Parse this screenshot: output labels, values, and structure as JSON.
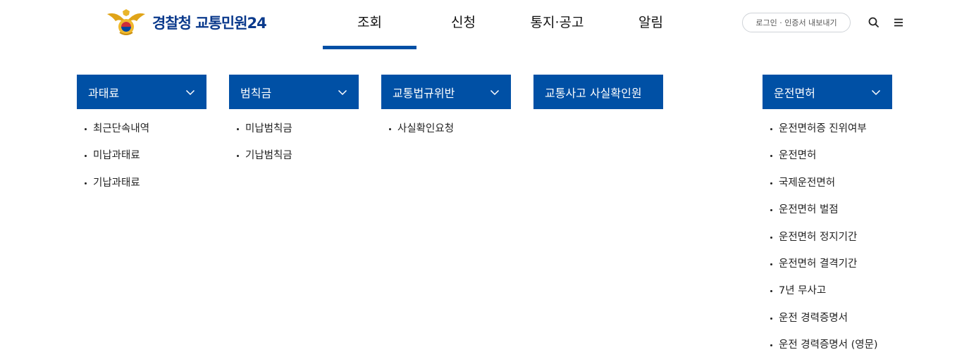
{
  "header": {
    "logo_text": "경찰청 교통민원24",
    "logo_icon": "police-emblem-icon",
    "nav": [
      {
        "label": "조회",
        "active": true
      },
      {
        "label": "신청",
        "active": false
      },
      {
        "label": "통지·공고",
        "active": false
      },
      {
        "label": "알림",
        "active": false
      }
    ],
    "login_label": "로그인  · 인증서 내보내기",
    "search_icon": "search-icon",
    "menu_icon": "menu-icon",
    "accent_color": "#0050a5"
  },
  "menu": {
    "columns": [
      {
        "title": "과태료",
        "has_toggle": true,
        "items": [
          "최근단속내역",
          "미납과태료",
          "기납과태료"
        ]
      },
      {
        "title": "범칙금",
        "has_toggle": true,
        "items": [
          "미납범칙금",
          "기납범칙금"
        ]
      },
      {
        "title": "교통법규위반",
        "has_toggle": true,
        "items": [
          "사실확인요청"
        ]
      },
      {
        "title": "교통사고 사실확인원",
        "has_toggle": false,
        "items": []
      },
      {
        "title": "운전면허",
        "has_toggle": true,
        "items": [
          "운전면허증 진위여부",
          "운전면허",
          "국제운전면허",
          "운전면허 벌점",
          "운전면허 정지기간",
          "운전면허 결격기간",
          "7년 무사고",
          "운전 경력증명서",
          "운전 경력증명서 (영문)"
        ]
      }
    ]
  }
}
